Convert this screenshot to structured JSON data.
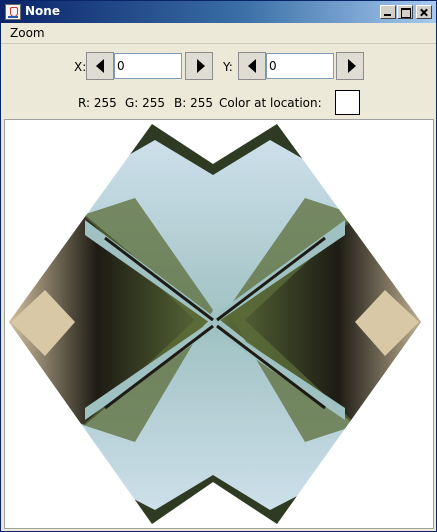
{
  "window": {
    "title": "None"
  },
  "menu": {
    "zoom": "Zoom"
  },
  "coords": {
    "x_label": "X:",
    "x_value": "0",
    "y_label": "Y:",
    "y_value": "0"
  },
  "color_info": {
    "r": "R: 255",
    "g": "G: 255",
    "b": "B: 255",
    "label": "Color at location:",
    "swatch_color": "#ffffff"
  },
  "picture": {
    "colors": {
      "sky": "#b6d2e6",
      "sky_light": "#d2e3ef",
      "trees": "#2e3b22",
      "foliage": "#5c6e3a",
      "water": "#9fc1c2",
      "path": "#d9c8a6",
      "shadow": "#1d1b14"
    }
  }
}
